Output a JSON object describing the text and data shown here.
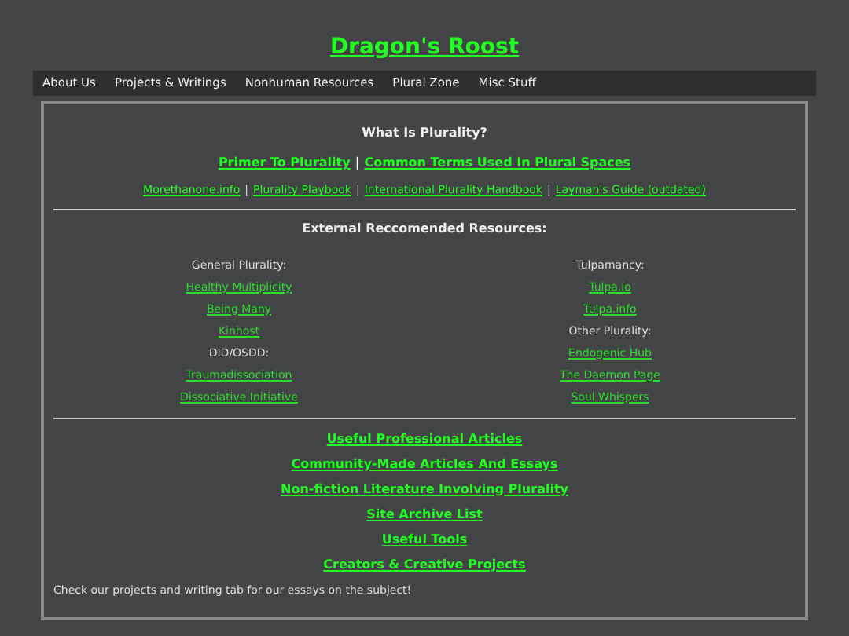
{
  "site_title": "Dragon's Roost",
  "nav": [
    {
      "label": "About Us"
    },
    {
      "label": "Projects & Writings"
    },
    {
      "label": "Nonhuman Resources"
    },
    {
      "label": "Plural Zone"
    },
    {
      "label": "Misc Stuff"
    }
  ],
  "intro": {
    "heading": "What Is Plurality?",
    "primary_line": [
      {
        "kind": "link",
        "text": "Primer To Plurality"
      },
      {
        "kind": "separator",
        "text": "|"
      },
      {
        "kind": "link",
        "text": "Common Terms Used In Plural Spaces"
      }
    ],
    "secondary_line": [
      {
        "kind": "link",
        "text": "Morethanone.info"
      },
      {
        "kind": "separator",
        "text": "|"
      },
      {
        "kind": "link",
        "text": "Plurality Playbook"
      },
      {
        "kind": "separator",
        "text": "|"
      },
      {
        "kind": "link",
        "text": "International Plurality Handbook"
      },
      {
        "kind": "separator",
        "text": "|"
      },
      {
        "kind": "link",
        "text": "Layman's Guide (outdated)"
      }
    ]
  },
  "resources": {
    "heading": "External Reccomended Resources:",
    "columns": [
      [
        {
          "kind": "heading",
          "text": "General Plurality:"
        },
        {
          "kind": "link",
          "text": "Healthy Multiplicity"
        },
        {
          "kind": "link",
          "text": "Being Many"
        },
        {
          "kind": "link",
          "text": "Kinhost"
        },
        {
          "kind": "heading",
          "text": "DID/OSDD:"
        },
        {
          "kind": "link",
          "text": "Traumadissociation"
        },
        {
          "kind": "link",
          "text": "Dissociative Initiative"
        }
      ],
      [
        {
          "kind": "heading",
          "text": "Tulpamancy:"
        },
        {
          "kind": "link",
          "text": "Tulpa.io"
        },
        {
          "kind": "link",
          "text": "Tulpa.info"
        },
        {
          "kind": "heading",
          "text": "Other Plurality:"
        },
        {
          "kind": "link",
          "text": "Endogenic Hub"
        },
        {
          "kind": "link",
          "text": "The Daemon Page"
        },
        {
          "kind": "link",
          "text": "Soul Whispers"
        }
      ]
    ]
  },
  "section_links": [
    "Useful Professional Articles",
    "Community-Made Articles And Essays",
    "Non-fiction Literature Involving Plurality",
    "Site Archive List",
    "Useful Tools",
    "Creators & Creative Projects"
  ],
  "footer_note": "Check our projects and writing tab for our essays on the subject!"
}
